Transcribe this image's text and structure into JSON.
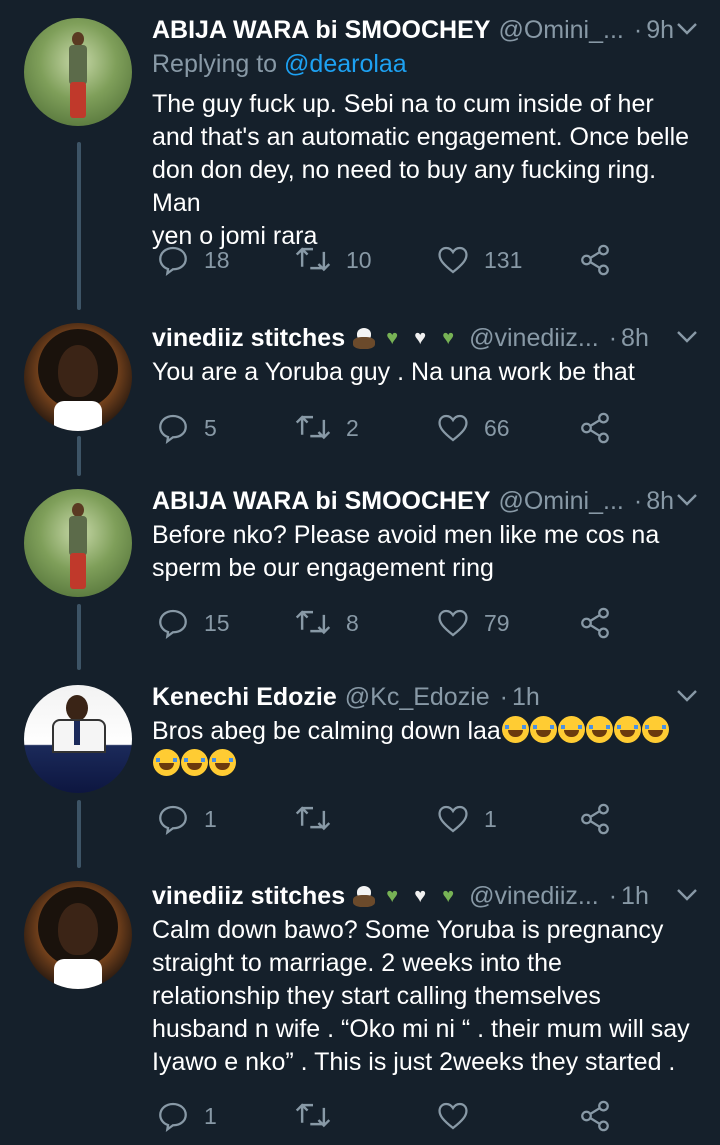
{
  "tweets": [
    {
      "name": "ABIJA WARA bi SMOOCHEY",
      "handle": "@Omini_...",
      "time": "9h",
      "replying_label": "Replying to",
      "replying_to": "@dearolaa",
      "text_lines": [
        "The guy fuck up. Sebi na to cum inside of her",
        "and that's an automatic engagement. Once belle",
        "don don dey, no need to buy any fucking ring. Man",
        "yen o jomi rara"
      ],
      "replies": "18",
      "retweets": "10",
      "likes": "131"
    },
    {
      "name": "vinediiz stitches",
      "handle": "@vinediiz...",
      "time": "8h",
      "text_lines": [
        "You are a Yoruba guy . Na una work be that"
      ],
      "replies": "5",
      "retweets": "2",
      "likes": "66"
    },
    {
      "name": "ABIJA WARA bi SMOOCHEY",
      "handle": "@Omini_...",
      "time": "8h",
      "text_lines": [
        "Before nko? Please avoid men like me cos na",
        "sperm be our engagement ring"
      ],
      "replies": "15",
      "retweets": "8",
      "likes": "79"
    },
    {
      "name": "Kenechi Edozie",
      "handle": "@Kc_Edozie",
      "time": "1h",
      "text_lines": [
        "Bros abeg be calming down laa"
      ],
      "replies": "1",
      "retweets": "",
      "likes": "1"
    },
    {
      "name": "vinediiz stitches",
      "handle": "@vinediiz...",
      "time": "1h",
      "text_lines": [
        "Calm down bawo? Some Yoruba is pregnancy",
        "straight to marriage. 2 weeks into the",
        "relationship they start calling themselves",
        "husband n wife . “Oko mi ni “ . their mum will say",
        "Iyawo e nko” . This is just 2weeks they started ."
      ],
      "replies": "1",
      "retweets": "",
      "likes": ""
    }
  ],
  "icons": {
    "reply": "reply-icon",
    "retweet": "retweet-icon",
    "like": "heart-icon",
    "share": "share-icon",
    "more": "chevron-down-icon",
    "verified_emoji": "eagle-emoji",
    "heart_green": "green-heart-emoji",
    "heart_white": "white-heart-emoji",
    "laugh": "laughing-emoji"
  },
  "colors": {
    "background": "#15202b",
    "text": "#ffffff",
    "muted": "#8899a6",
    "mention": "#1da1f2",
    "thread_line": "#3d5466"
  }
}
